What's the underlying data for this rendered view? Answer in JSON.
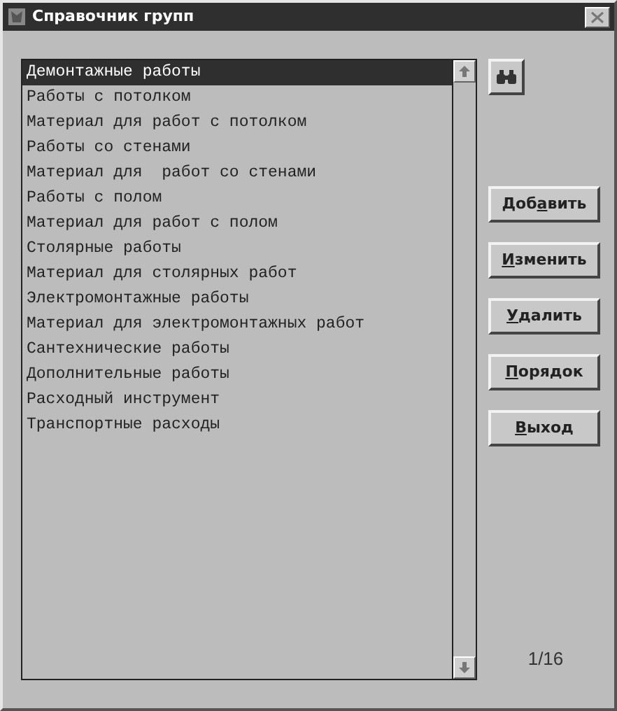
{
  "window": {
    "title": "Справочник групп"
  },
  "list": {
    "items": [
      {
        "label": "Демонтажные работы",
        "selected": true
      },
      {
        "label": "Работы с потолком",
        "selected": false
      },
      {
        "label": "Материал для работ с потолком",
        "selected": false
      },
      {
        "label": "Работы со стенами",
        "selected": false
      },
      {
        "label": "Материал для  работ со стенами",
        "selected": false
      },
      {
        "label": "Работы с полом",
        "selected": false
      },
      {
        "label": "Материал для работ с полом",
        "selected": false
      },
      {
        "label": "Столярные работы",
        "selected": false
      },
      {
        "label": "Материал для столярных работ",
        "selected": false
      },
      {
        "label": "Электромонтажные работы",
        "selected": false
      },
      {
        "label": "Материал для электромонтажных работ",
        "selected": false
      },
      {
        "label": "Сантехнические работы",
        "selected": false
      },
      {
        "label": "Дополнительные работы",
        "selected": false
      },
      {
        "label": "Расходный инструмент",
        "selected": false
      },
      {
        "label": "Транспортные расходы",
        "selected": false
      }
    ]
  },
  "buttons": [
    {
      "before": "Доб",
      "underlined": "а",
      "after": "вить"
    },
    {
      "underlined": "И",
      "after": "зменить"
    },
    {
      "underlined": "У",
      "after": "далить"
    },
    {
      "underlined": "П",
      "after": "орядок"
    },
    {
      "underlined": "В",
      "after": "ыход"
    }
  ],
  "counter": "1/16"
}
